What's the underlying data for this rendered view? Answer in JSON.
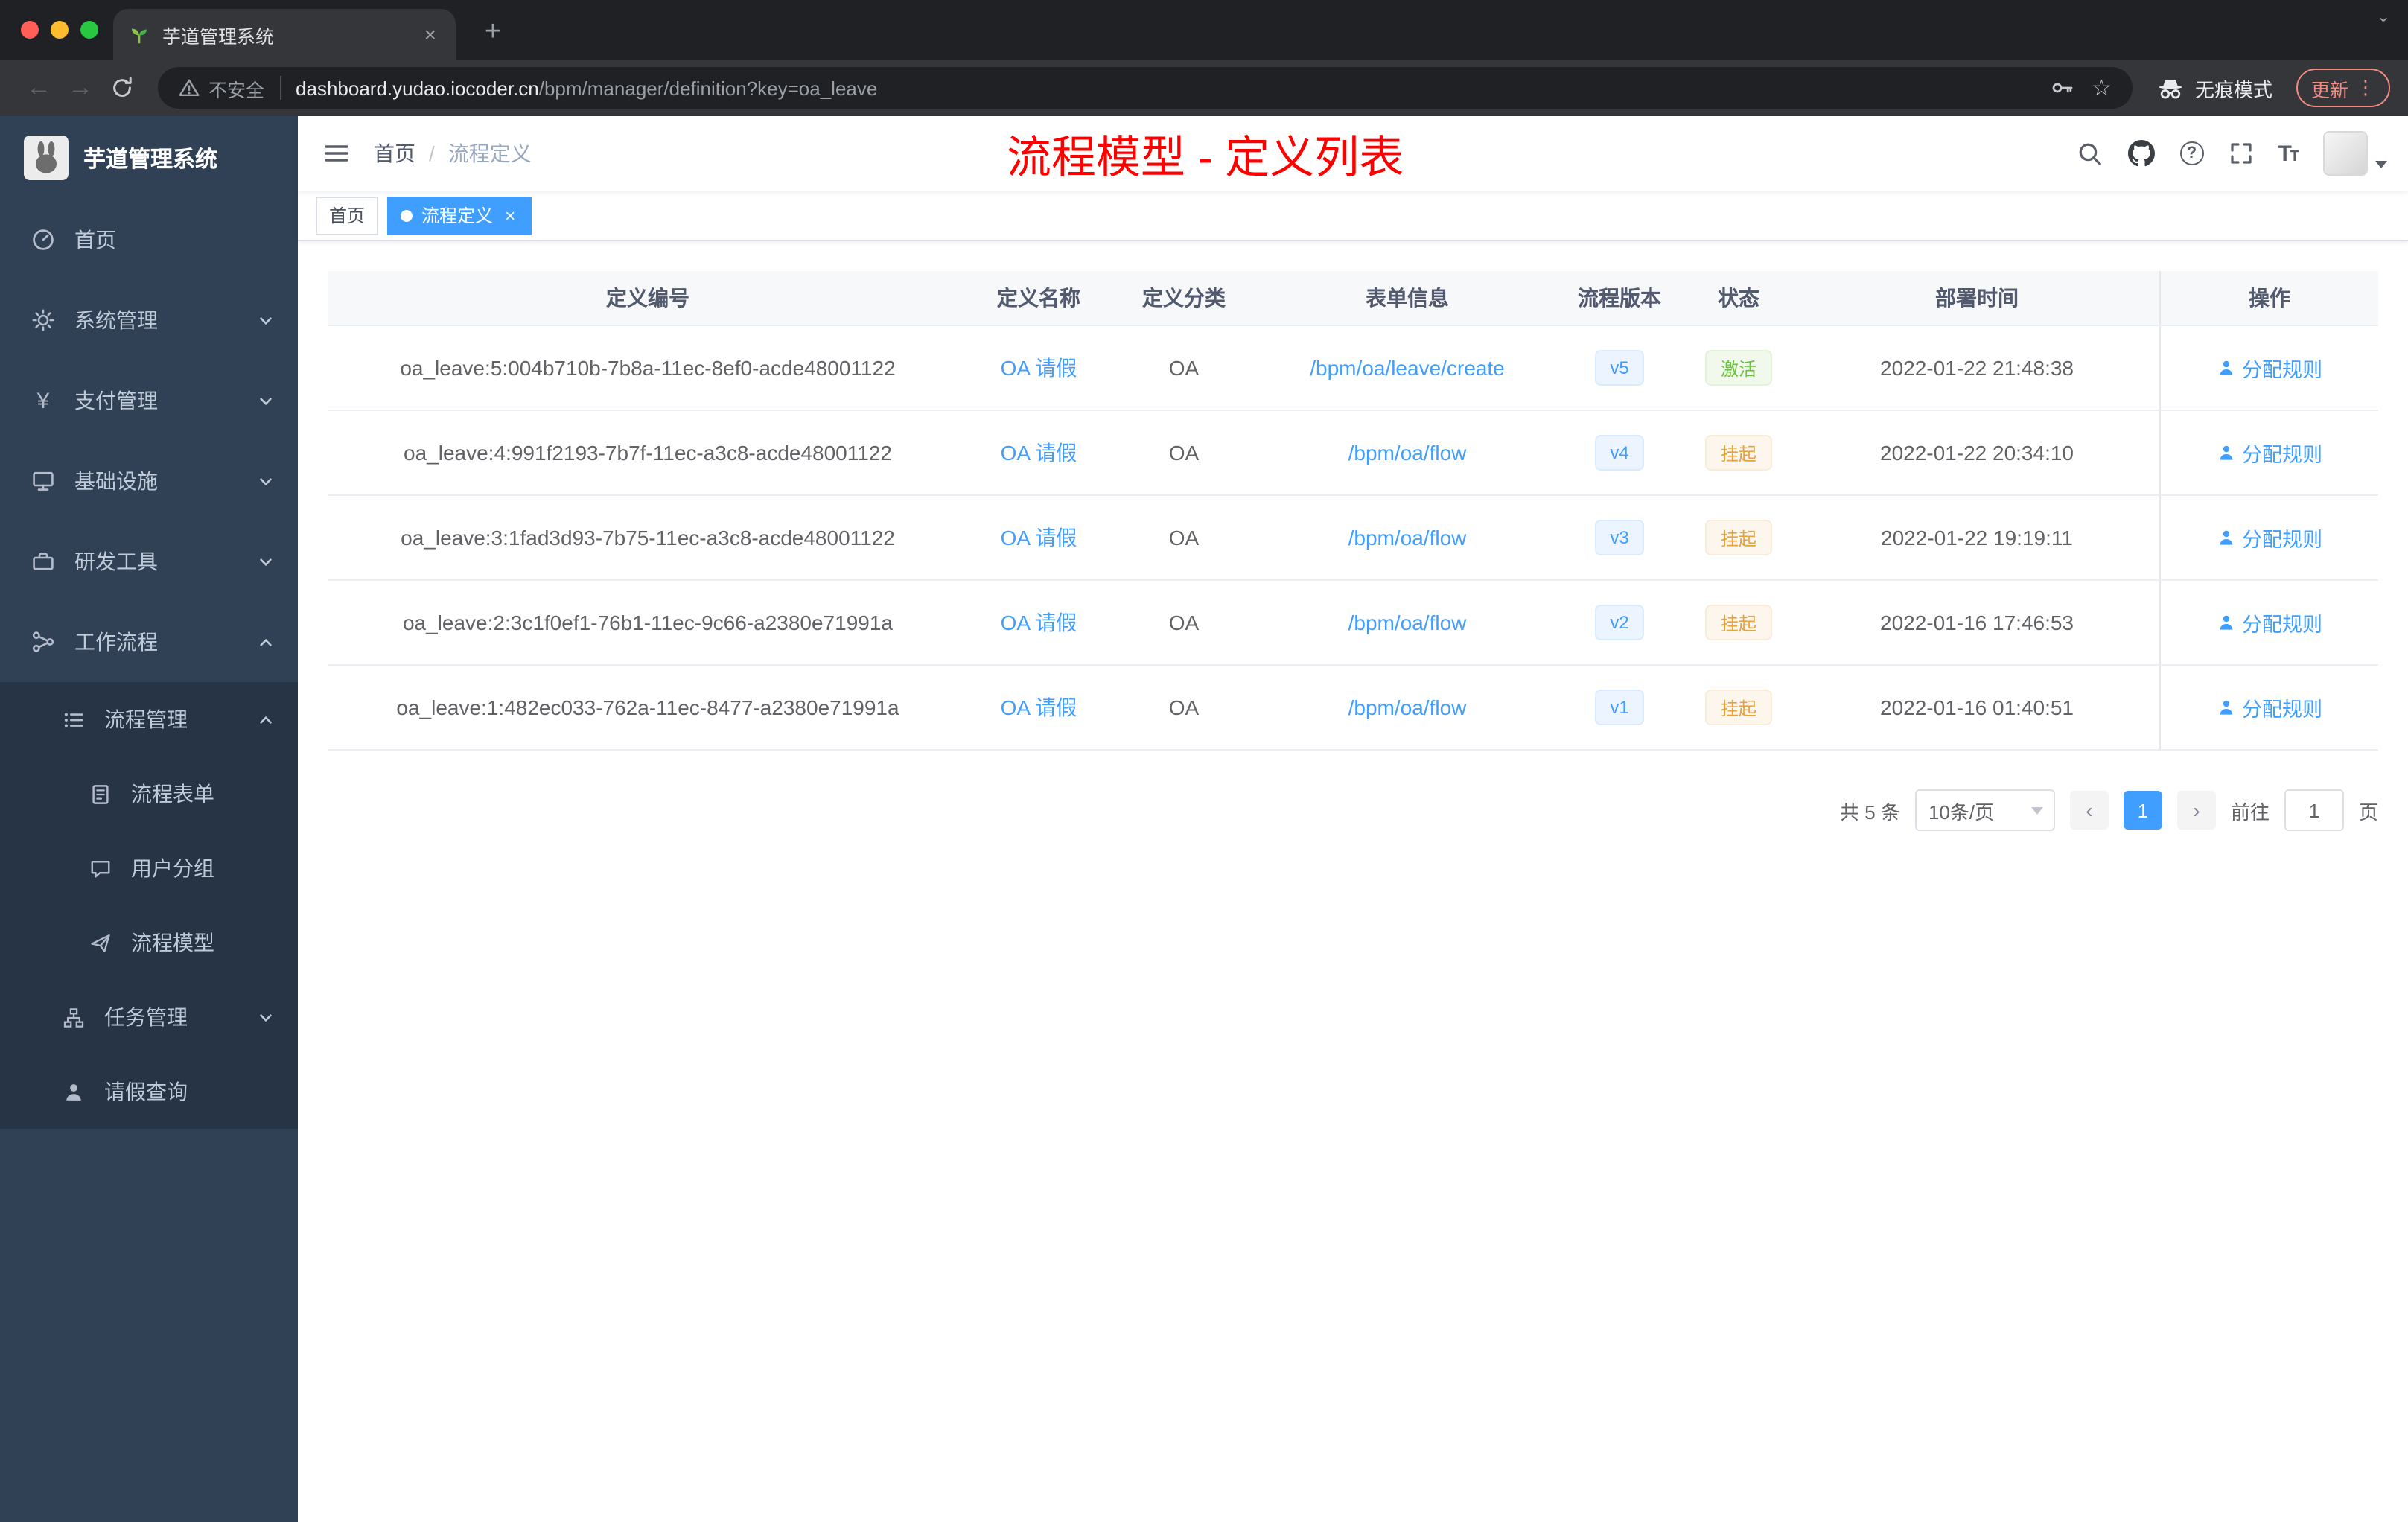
{
  "icons": {
    "back": "←",
    "forward": "→",
    "star": "☆",
    "menu_dots": "⋮",
    "yen": "¥",
    "help": "?",
    "close": "×",
    "plus": "+",
    "caret": "ˇ"
  },
  "browser": {
    "tab_title": "芋道管理系统",
    "security_label": "不安全",
    "url_host": "dashboard.yudao.iocoder.cn",
    "url_path": "/bpm/manager/definition?key=oa_leave",
    "incognito_label": "无痕模式",
    "update_label": "更新"
  },
  "sidebar": {
    "brand": "芋道管理系统",
    "items": [
      {
        "label": "首页"
      },
      {
        "label": "系统管理"
      },
      {
        "label": "支付管理"
      },
      {
        "label": "基础设施"
      },
      {
        "label": "研发工具"
      },
      {
        "label": "工作流程"
      },
      {
        "label": "流程管理"
      },
      {
        "label": "流程表单"
      },
      {
        "label": "用户分组"
      },
      {
        "label": "流程模型"
      },
      {
        "label": "任务管理"
      },
      {
        "label": "请假查询"
      }
    ]
  },
  "header": {
    "breadcrumb_home": "首页",
    "breadcrumb_separator": "/",
    "breadcrumb_current": "流程定义",
    "annotation": "流程模型 - 定义列表"
  },
  "tags": {
    "home": "首页",
    "active": "流程定义"
  },
  "table": {
    "columns": [
      "定义编号",
      "定义名称",
      "定义分类",
      "表单信息",
      "流程版本",
      "状态",
      "部署时间",
      "操作"
    ],
    "rows": [
      {
        "id": "oa_leave:5:004b710b-7b8a-11ec-8ef0-acde48001122",
        "name": "OA 请假",
        "category": "OA",
        "form": "/bpm/oa/leave/create",
        "version": "v5",
        "status": "激活",
        "status_type": "success",
        "time": "2022-01-22 21:48:38",
        "action": "分配规则"
      },
      {
        "id": "oa_leave:4:991f2193-7b7f-11ec-a3c8-acde48001122",
        "name": "OA 请假",
        "category": "OA",
        "form": "/bpm/oa/flow",
        "version": "v4",
        "status": "挂起",
        "status_type": "warning",
        "time": "2022-01-22 20:34:10",
        "action": "分配规则"
      },
      {
        "id": "oa_leave:3:1fad3d93-7b75-11ec-a3c8-acde48001122",
        "name": "OA 请假",
        "category": "OA",
        "form": "/bpm/oa/flow",
        "version": "v3",
        "status": "挂起",
        "status_type": "warning",
        "time": "2022-01-22 19:19:11",
        "action": "分配规则"
      },
      {
        "id": "oa_leave:2:3c1f0ef1-76b1-11ec-9c66-a2380e71991a",
        "name": "OA 请假",
        "category": "OA",
        "form": "/bpm/oa/flow",
        "version": "v2",
        "status": "挂起",
        "status_type": "warning",
        "time": "2022-01-16 17:46:53",
        "action": "分配规则"
      },
      {
        "id": "oa_leave:1:482ec033-762a-11ec-8477-a2380e71991a",
        "name": "OA 请假",
        "category": "OA",
        "form": "/bpm/oa/flow",
        "version": "v1",
        "status": "挂起",
        "status_type": "warning",
        "time": "2022-01-16 01:40:51",
        "action": "分配规则"
      }
    ]
  },
  "pagination": {
    "total": "共 5 条",
    "page_size": "10条/页",
    "prev": "‹",
    "current_page": "1",
    "next": "›",
    "goto_label": "前往",
    "goto_value": "1",
    "page_unit": "页"
  }
}
